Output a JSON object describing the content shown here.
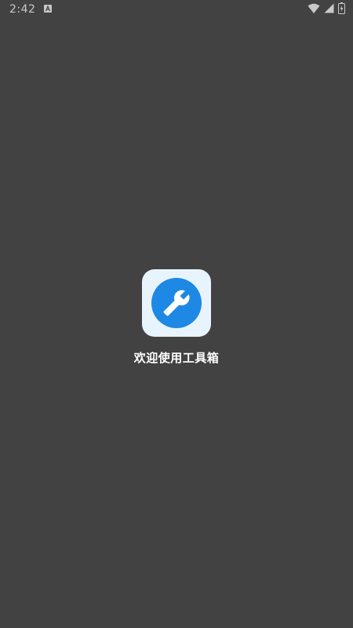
{
  "status_bar": {
    "time": "2:42",
    "icons": [
      "notification-a-icon",
      "wifi-icon",
      "signal-icon",
      "battery-icon"
    ]
  },
  "splash": {
    "icon": "wrench-icon",
    "welcome_text": "欢迎使用工具箱",
    "colors": {
      "background": "#424242",
      "icon_tile": "#e8f4fd",
      "icon_circle": "#1e88e5",
      "text": "#ffffff"
    }
  }
}
